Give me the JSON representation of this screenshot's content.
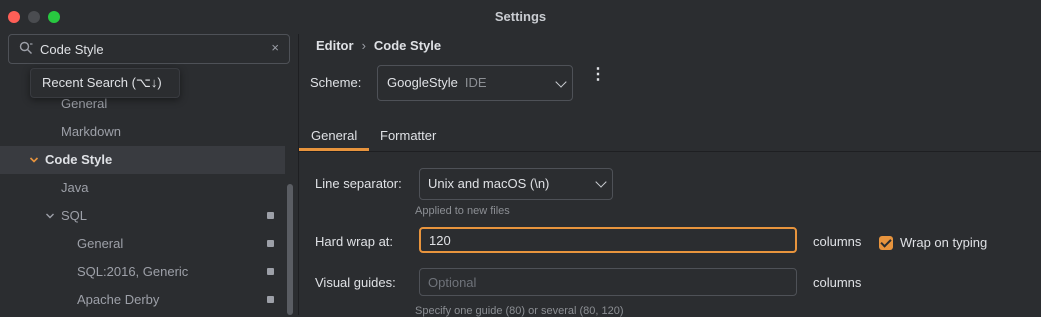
{
  "window": {
    "title": "Settings"
  },
  "search": {
    "value": "Code Style",
    "clear_icon": "×"
  },
  "recent_search": {
    "label": "Recent Search (⌥↓)"
  },
  "tree": {
    "items": [
      {
        "label": "General"
      },
      {
        "label": "Markdown"
      },
      {
        "label": "Code Style"
      },
      {
        "label": "Java"
      },
      {
        "label": "SQL"
      },
      {
        "label": "General"
      },
      {
        "label": "SQL:2016, Generic"
      },
      {
        "label": "Apache Derby"
      }
    ]
  },
  "breadcrumb": {
    "parent": "Editor",
    "separator": "›",
    "current": "Code Style"
  },
  "scheme": {
    "label": "Scheme:",
    "value": "GoogleStyle",
    "sublabel": "IDE",
    "more_icon": "⋮"
  },
  "tabs": [
    {
      "label": "General"
    },
    {
      "label": "Formatter"
    }
  ],
  "general": {
    "line_separator": {
      "label": "Line separator:",
      "value": "Unix and macOS (\\n)",
      "hint": "Applied to new files"
    },
    "hard_wrap": {
      "label": "Hard wrap at:",
      "value": "120",
      "unit": "columns"
    },
    "wrap_on_typing": {
      "label": "Wrap on typing",
      "checked": true
    },
    "visual_guides": {
      "label": "Visual guides:",
      "placeholder": "Optional",
      "unit": "columns",
      "hint": "Specify one guide (80) or several (80, 120)"
    }
  },
  "colors": {
    "accent": "#e8943d",
    "background": "#2b2d30",
    "selection": "#393b40"
  }
}
